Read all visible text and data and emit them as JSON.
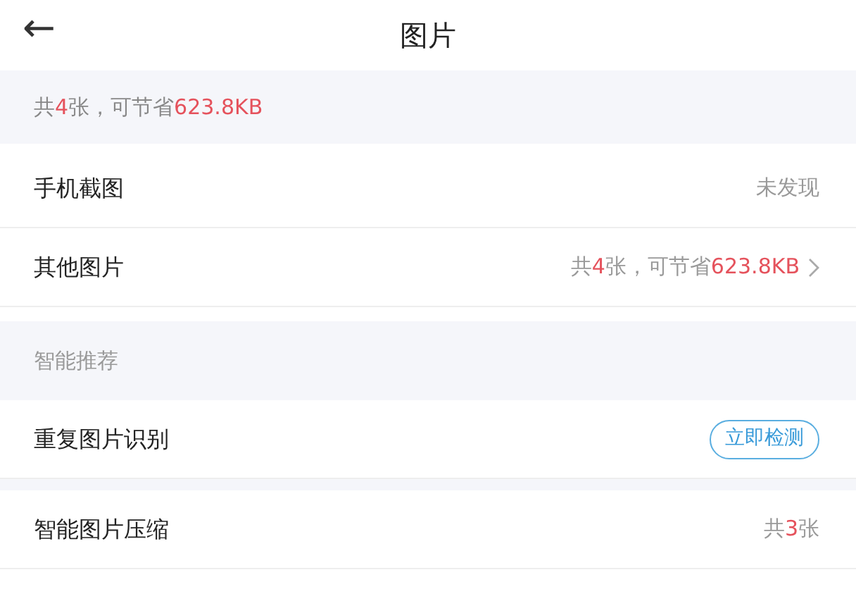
{
  "header": {
    "back": "←",
    "title": "图片"
  },
  "summary": "共**4**张，可节省**623.8KB**",
  "rows": [
    {
      "kind": "item",
      "label": "手机截图",
      "value": "未发现",
      "chevron": false
    },
    {
      "kind": "item",
      "label": "其他图片",
      "value": "共**4**张，可节省**623.8KB**",
      "chevron": true
    },
    {
      "kind": "section",
      "label": "智能推荐"
    },
    {
      "kind": "action",
      "label": "重复图片识别",
      "button": "立即检测"
    },
    {
      "kind": "item",
      "label": "智能图片压缩",
      "value": "共**3**张",
      "chevron": false
    }
  ]
}
